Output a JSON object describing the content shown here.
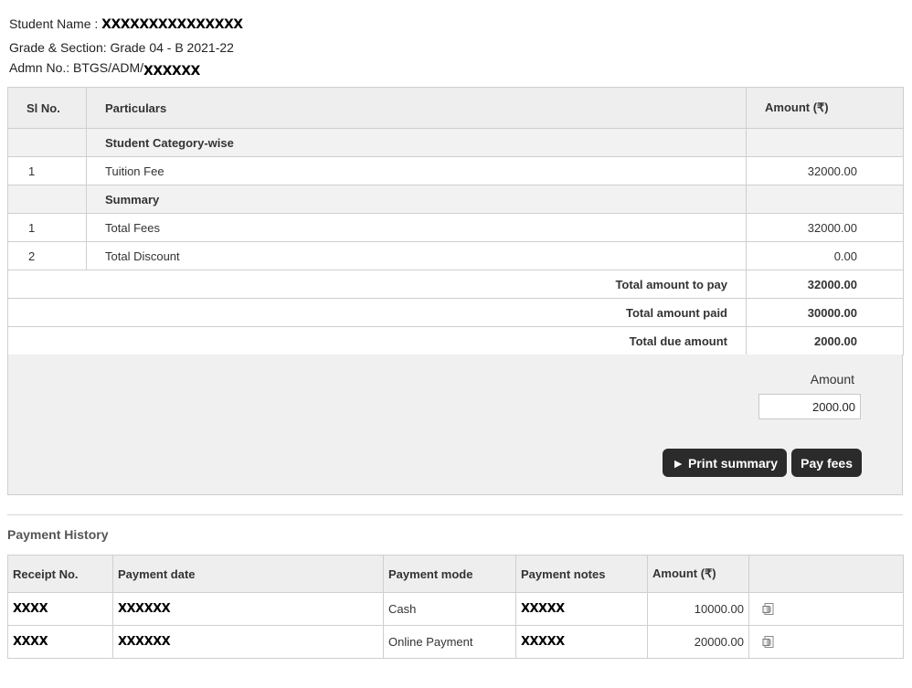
{
  "student": {
    "name_label": "Student Name :",
    "name_value": "XXXXXXXXXXXXXXX",
    "grade_label": "Grade & Section:",
    "grade_value": "Grade 04 - B 2021-22",
    "admn_label": "Admn No.:",
    "admn_prefix": "BTGS/ADM/",
    "admn_redacted": "XXXXXX"
  },
  "fees_table": {
    "headers": {
      "sl_no": "Sl No.",
      "particulars": "Particulars",
      "amount": "Amount (₹)"
    },
    "category_row": "Student Category-wise",
    "category_items": [
      {
        "sl": "1",
        "particular": "Tuition Fee",
        "amount": "32000.00"
      }
    ],
    "summary_row": "Summary",
    "summary_items": [
      {
        "sl": "1",
        "particular": "Total Fees",
        "amount": "32000.00"
      },
      {
        "sl": "2",
        "particular": "Total Discount",
        "amount": "0.00"
      }
    ],
    "totals": [
      {
        "label": "Total amount to pay",
        "value": "32000.00"
      },
      {
        "label": "Total amount paid",
        "value": "30000.00"
      },
      {
        "label": "Total due amount",
        "value": "2000.00"
      }
    ]
  },
  "payment": {
    "amount_label": "Amount",
    "amount_value": "2000.00",
    "print_button": "► Print summary",
    "pay_button": "Pay fees"
  },
  "history": {
    "title": "Payment History",
    "headers": {
      "receipt": "Receipt No.",
      "date": "Payment date",
      "mode": "Payment mode",
      "notes": "Payment notes",
      "amount": "Amount (₹)"
    },
    "rows": [
      {
        "receipt": "XXXX",
        "date": "XXXXXX",
        "mode": "Cash",
        "notes": "XXXXX",
        "amount": "10000.00",
        "icon": "receipt-doc-icon"
      },
      {
        "receipt": "XXXX",
        "date": "XXXXXX",
        "mode": "Online Payment",
        "notes": "XXXXX",
        "amount": "20000.00",
        "icon": "receipt-doc-icon"
      }
    ]
  },
  "colors": {
    "button_bg": "#2b2b2b",
    "header_bg": "#eeeeee",
    "panel_bg": "#f0f0f0"
  }
}
